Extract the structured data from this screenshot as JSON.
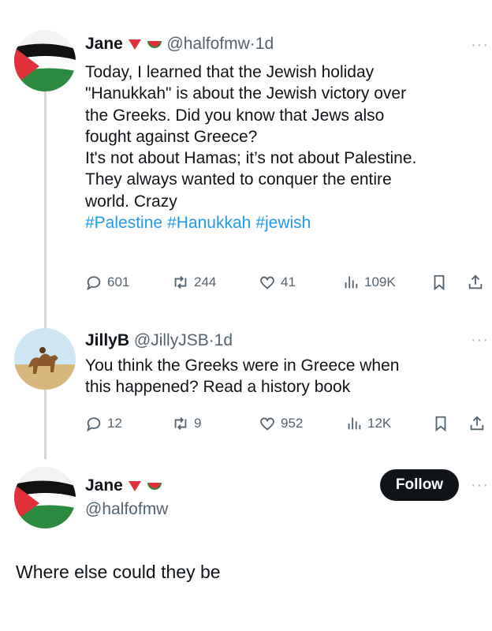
{
  "tweet1": {
    "name": "Jane",
    "handle": "@halfofmw",
    "time": "1d",
    "lines": [
      "Today, I learned that the Jewish holiday",
      "\"Hanukkah\" is about the Jewish victory over",
      "the Greeks. Did you know that Jews also",
      "fought against Greece?",
      "It's not about Hamas; it’s not about Palestine.",
      "They always wanted to conquer the entire",
      "world. Crazy"
    ],
    "hashtags": [
      "#Palestine",
      "#Hanukkah",
      "#jewish"
    ],
    "replies": "601",
    "retweets": "244",
    "likes": "41",
    "views": "109K"
  },
  "tweet2": {
    "name": "JillyB",
    "handle": "@JillyJSB",
    "time": "1d",
    "lines": [
      "You think the Greeks were in Greece when",
      "this happened? Read a history book"
    ],
    "replies": "12",
    "retweets": "9",
    "likes": "952",
    "views": "12K"
  },
  "tweet3": {
    "name": "Jane",
    "handle": "@halfofmw",
    "follow_label": "Follow",
    "text": "Where else could they be"
  },
  "more_label": "···",
  "dot": "·",
  "colors": {
    "accent": "#1d9bf0",
    "muted": "#536471",
    "flag_red": "#e0313a",
    "flag_green": "#2c8a3e"
  },
  "icons": [
    "reply-icon",
    "retweet-icon",
    "like-icon",
    "views-icon",
    "bookmark-icon",
    "share-icon",
    "more-icon",
    "heart-triangle-icon",
    "watermelon-icon"
  ]
}
